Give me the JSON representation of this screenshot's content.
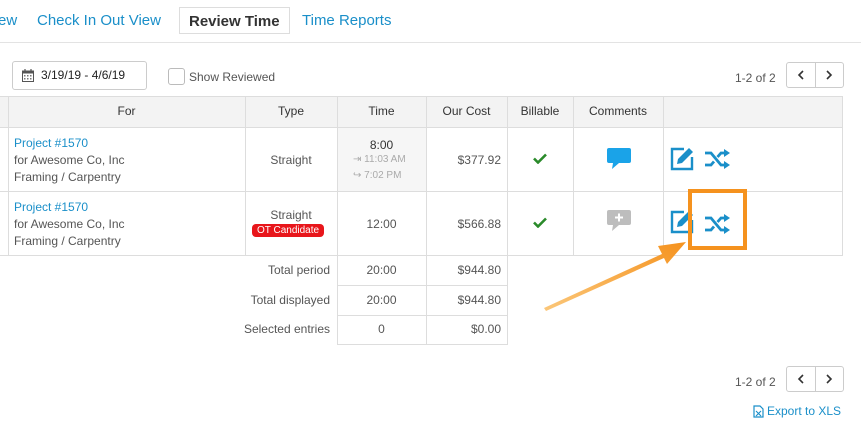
{
  "tabs": [
    {
      "label": "ew"
    },
    {
      "label": "Check In Out View"
    },
    {
      "label": "Review Time",
      "active": true
    },
    {
      "label": "Time Reports"
    }
  ],
  "filters": {
    "date_range": "3/19/19 - 4/6/19",
    "show_reviewed_label": "Show Reviewed",
    "show_reviewed_checked": false
  },
  "pager": {
    "text": "1-2 of 2"
  },
  "table": {
    "headers": {
      "for": "For",
      "type": "Type",
      "time": "Time",
      "our_cost": "Our Cost",
      "billable": "Billable",
      "comments": "Comments"
    },
    "rows": [
      {
        "project": "Project #1570",
        "client": "for Awesome Co, Inc",
        "task": "Framing / Carpentry",
        "type": "Straight",
        "badge": "",
        "time": "8:00",
        "time_in": "11:03 AM",
        "time_out": "7:02 PM",
        "cost": "$377.92",
        "billable": true,
        "has_comment": true
      },
      {
        "project": "Project #1570",
        "client": "for Awesome Co, Inc",
        "task": "Framing / Carpentry",
        "type": "Straight",
        "badge": "OT Candidate",
        "time": "12:00",
        "time_in": "",
        "time_out": "",
        "cost": "$566.88",
        "billable": true,
        "has_comment": false
      }
    ],
    "totals": [
      {
        "label": "Total period",
        "time": "20:00",
        "cost": "$944.80"
      },
      {
        "label": "Total displayed",
        "time": "20:00",
        "cost": "$944.80"
      },
      {
        "label": "Selected entries",
        "time": "0",
        "cost": "$0.00"
      }
    ]
  },
  "export_label": "Export to XLS",
  "colors": {
    "link": "#1a8fc9",
    "check": "#2a8a2a",
    "badge": "#e8161b",
    "highlight": "#f5921e",
    "comment_active": "#1aa3e8",
    "comment_empty": "#bdbdbd"
  }
}
